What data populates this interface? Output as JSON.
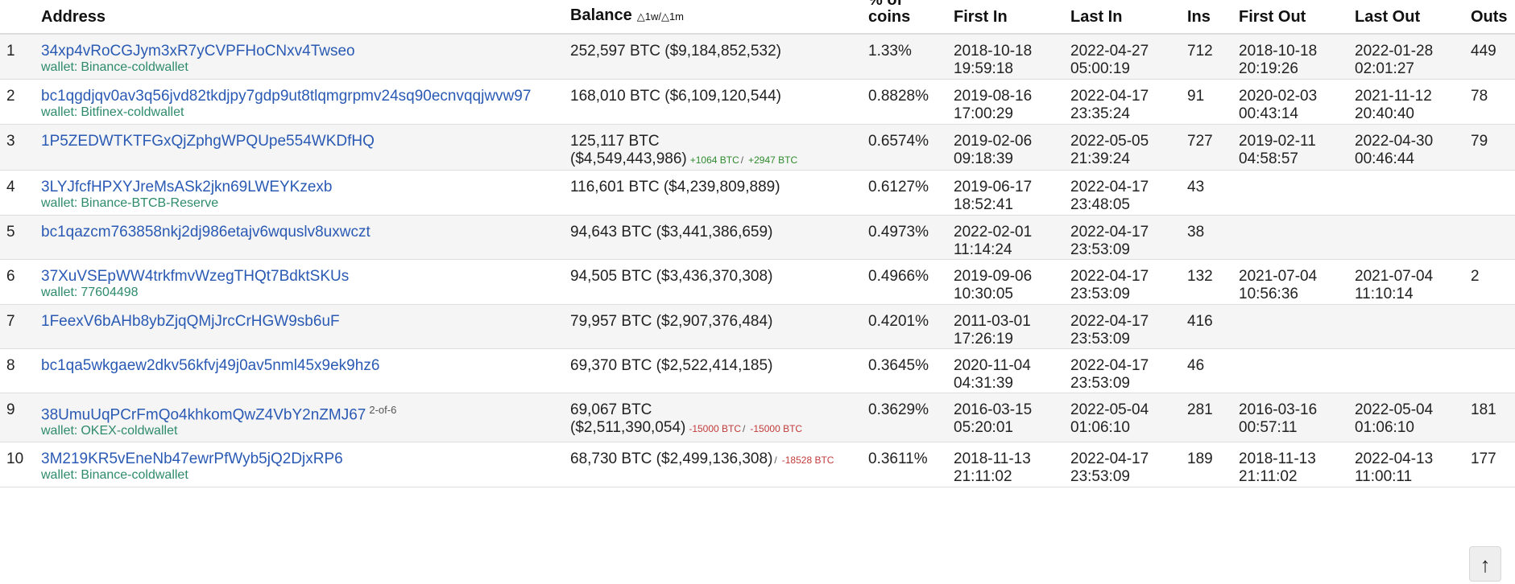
{
  "colors": {
    "link": "#2a5ab4",
    "wallet": "#2e8b6b",
    "positive": "#2e8b2e",
    "negative": "#c23b3b",
    "row_stripe": "#f5f5f5"
  },
  "columns": {
    "address": "Address",
    "balance": "Balance",
    "balance_delta": "△1w/△1m",
    "pct_line1": "% of",
    "pct_line2": "coins",
    "first_in": "First In",
    "last_in": "Last In",
    "ins": "Ins",
    "first_out": "First Out",
    "last_out": "Last Out",
    "outs": "Outs"
  },
  "wallet_prefix": "wallet:",
  "scroll_top_icon": "↑",
  "rows": [
    {
      "rank": "1",
      "address": "34xp4vRoCGJym3xR7yCVPFHoCNxv4Twseo",
      "wallet": "Binance-coldwallet",
      "sig": "",
      "balance_line1": "252,597 BTC ($9,184,852,532)",
      "balance_line2": "",
      "chg1": "",
      "chg2": "",
      "pct": "1.33%",
      "first_in_date": "2018-10-18",
      "first_in_time": "19:59:18",
      "last_in_date": "2022-04-27",
      "last_in_time": "05:00:19",
      "ins": "712",
      "first_out_date": "2018-10-18",
      "first_out_time": "20:19:26",
      "last_out_date": "2022-01-28",
      "last_out_time": "02:01:27",
      "outs": "449"
    },
    {
      "rank": "2",
      "address": "bc1qgdjqv0av3q56jvd82tkdjpy7gdp9ut8tlqmgrpmv24sq90ecnvqqjwvw97",
      "wallet": "Bitfinex-coldwallet",
      "sig": "",
      "balance_line1": "168,010 BTC ($6,109,120,544)",
      "balance_line2": "",
      "chg1": "",
      "chg2": "",
      "pct": "0.8828%",
      "first_in_date": "2019-08-16",
      "first_in_time": "17:00:29",
      "last_in_date": "2022-04-17",
      "last_in_time": "23:35:24",
      "ins": "91",
      "first_out_date": "2020-02-03",
      "first_out_time": "00:43:14",
      "last_out_date": "2021-11-12",
      "last_out_time": "20:40:40",
      "outs": "78"
    },
    {
      "rank": "3",
      "address": "1P5ZEDWTKTFGxQjZphgWPQUpe554WKDfHQ",
      "wallet": "",
      "sig": "",
      "balance_line1": "125,117 BTC",
      "balance_line2": "($4,549,443,986)",
      "chg1": "+1064 BTC",
      "chg2": "+2947 BTC",
      "pct": "0.6574%",
      "first_in_date": "2019-02-06",
      "first_in_time": "09:18:39",
      "last_in_date": "2022-05-05",
      "last_in_time": "21:39:24",
      "ins": "727",
      "first_out_date": "2019-02-11",
      "first_out_time": "04:58:57",
      "last_out_date": "2022-04-30",
      "last_out_time": "00:46:44",
      "outs": "79"
    },
    {
      "rank": "4",
      "address": "3LYJfcfHPXYJreMsASk2jkn69LWEYKzexb",
      "wallet": "Binance-BTCB-Reserve",
      "sig": "",
      "balance_line1": "116,601 BTC ($4,239,809,889)",
      "balance_line2": "",
      "chg1": "",
      "chg2": "",
      "pct": "0.6127%",
      "first_in_date": "2019-06-17",
      "first_in_time": "18:52:41",
      "last_in_date": "2022-04-17",
      "last_in_time": "23:48:05",
      "ins": "43",
      "first_out_date": "",
      "first_out_time": "",
      "last_out_date": "",
      "last_out_time": "",
      "outs": ""
    },
    {
      "rank": "5",
      "address": "bc1qazcm763858nkj2dj986etajv6wquslv8uxwczt",
      "wallet": "",
      "sig": "",
      "balance_line1": "94,643 BTC ($3,441,386,659)",
      "balance_line2": "",
      "chg1": "",
      "chg2": "",
      "pct": "0.4973%",
      "first_in_date": "2022-02-01",
      "first_in_time": "11:14:24",
      "last_in_date": "2022-04-17",
      "last_in_time": "23:53:09",
      "ins": "38",
      "first_out_date": "",
      "first_out_time": "",
      "last_out_date": "",
      "last_out_time": "",
      "outs": ""
    },
    {
      "rank": "6",
      "address": "37XuVSEpWW4trkfmvWzegTHQt7BdktSKUs",
      "wallet": "77604498",
      "sig": "",
      "balance_line1": "94,505 BTC ($3,436,370,308)",
      "balance_line2": "",
      "chg1": "",
      "chg2": "",
      "pct": "0.4966%",
      "first_in_date": "2019-09-06",
      "first_in_time": "10:30:05",
      "last_in_date": "2022-04-17",
      "last_in_time": "23:53:09",
      "ins": "132",
      "first_out_date": "2021-07-04",
      "first_out_time": "10:56:36",
      "last_out_date": "2021-07-04",
      "last_out_time": "11:10:14",
      "outs": "2"
    },
    {
      "rank": "7",
      "address": "1FeexV6bAHb8ybZjqQMjJrcCrHGW9sb6uF",
      "wallet": "",
      "sig": "",
      "balance_line1": "79,957 BTC ($2,907,376,484)",
      "balance_line2": "",
      "chg1": "",
      "chg2": "",
      "pct": "0.4201%",
      "first_in_date": "2011-03-01",
      "first_in_time": "17:26:19",
      "last_in_date": "2022-04-17",
      "last_in_time": "23:53:09",
      "ins": "416",
      "first_out_date": "",
      "first_out_time": "",
      "last_out_date": "",
      "last_out_time": "",
      "outs": ""
    },
    {
      "rank": "8",
      "address": "bc1qa5wkgaew2dkv56kfvj49j0av5nml45x9ek9hz6",
      "wallet": "",
      "sig": "",
      "balance_line1": "69,370 BTC ($2,522,414,185)",
      "balance_line2": "",
      "chg1": "",
      "chg2": "",
      "pct": "0.3645%",
      "first_in_date": "2020-11-04",
      "first_in_time": "04:31:39",
      "last_in_date": "2022-04-17",
      "last_in_time": "23:53:09",
      "ins": "46",
      "first_out_date": "",
      "first_out_time": "",
      "last_out_date": "",
      "last_out_time": "",
      "outs": ""
    },
    {
      "rank": "9",
      "address": "38UmuUqPCrFmQo4khkomQwZ4VbY2nZMJ67",
      "wallet": "OKEX-coldwallet",
      "sig": "2-of-6",
      "balance_line1": "69,067 BTC",
      "balance_line2": "($2,511,390,054)",
      "chg1": "-15000 BTC",
      "chg2": "-15000 BTC",
      "pct": "0.3629%",
      "first_in_date": "2016-03-15",
      "first_in_time": "05:20:01",
      "last_in_date": "2022-05-04",
      "last_in_time": "01:06:10",
      "ins": "281",
      "first_out_date": "2016-03-16",
      "first_out_time": "00:57:11",
      "last_out_date": "2022-05-04",
      "last_out_time": "01:06:10",
      "outs": "181"
    },
    {
      "rank": "10",
      "address": "3M219KR5vEneNb47ewrPfWyb5jQ2DjxRP6",
      "wallet": "Binance-coldwallet",
      "sig": "",
      "balance_line1": "68,730 BTC ($2,499,136,308)",
      "balance_line2": "",
      "chg1": "",
      "chg2": "-18528 BTC",
      "pct": "0.3611%",
      "first_in_date": "2018-11-13",
      "first_in_time": "21:11:02",
      "last_in_date": "2022-04-17",
      "last_in_time": "23:53:09",
      "ins": "189",
      "first_out_date": "2018-11-13",
      "first_out_time": "21:11:02",
      "last_out_date": "2022-04-13",
      "last_out_time": "11:00:11",
      "outs": "177"
    }
  ]
}
